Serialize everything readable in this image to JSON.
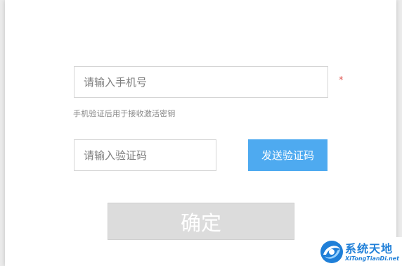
{
  "form": {
    "phone_placeholder": "请输入手机号",
    "phone_value": "",
    "required_mark": "*",
    "hint": "手机验证后用于接收激活密钥",
    "code_placeholder": "请输入验证码",
    "code_value": "",
    "send_code_label": "发送验证码",
    "confirm_label": "确定"
  },
  "watermark": {
    "title": "系统天地",
    "subtitle": "XiTongTianDi.net",
    "icon": "swirl-logo-icon"
  },
  "colors": {
    "accent": "#4eaaf0",
    "required": "#e05a55",
    "confirm_disabled": "#dcdcdc",
    "watermark": "#1f7fd8"
  }
}
